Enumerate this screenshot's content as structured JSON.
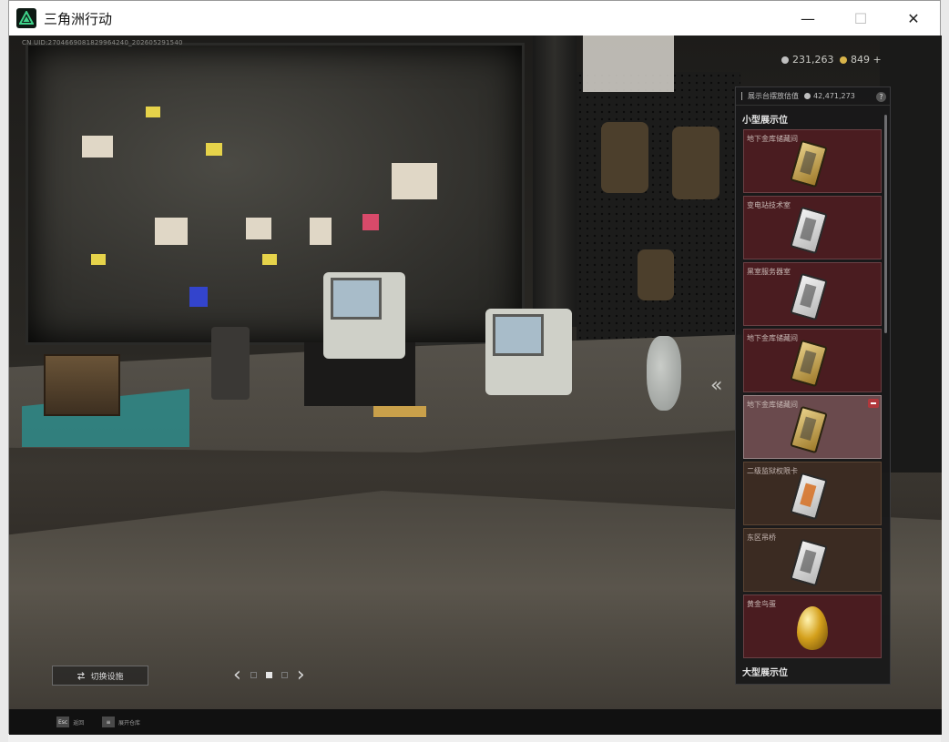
{
  "window": {
    "title": "三角洲行动",
    "controls": {
      "minimize": "—",
      "maximize": "☐",
      "close": "✕"
    }
  },
  "uid_text": "CN UID:2704669081829964240_202605291540",
  "currency": [
    {
      "value": "231,263",
      "icon": "silver-coin-icon",
      "color": "#bfbfbf"
    },
    {
      "value": "849 +",
      "icon": "gold-coin-icon",
      "color": "#d9b44a"
    }
  ],
  "panel": {
    "header_label": "展示台摆放估值",
    "header_value": "42,471,273",
    "help_label": "?",
    "small_section_title": "小型展示位",
    "large_section_title": "大型展示位",
    "slots": [
      {
        "name": "地下金库储藏间",
        "item": "gold-keycard",
        "style": "red"
      },
      {
        "name": "变电站技术室",
        "item": "white-keycard",
        "style": "red"
      },
      {
        "name": "黑室服务器室",
        "item": "white-keycard",
        "style": "red"
      },
      {
        "name": "地下金库储藏间",
        "item": "gold-keycard",
        "style": "red"
      },
      {
        "name": "地下金库储藏间",
        "item": "gold-keycard",
        "style": "selected"
      },
      {
        "name": "二级监狱权限卡",
        "item": "white-orange-keycard",
        "style": "brown"
      },
      {
        "name": "东区吊桥",
        "item": "white-keycard",
        "style": "brown"
      },
      {
        "name": "黄金鸟蛋",
        "item": "golden-egg",
        "style": "red"
      }
    ]
  },
  "collapse_label": "«",
  "switch_button": {
    "label": "切换设施",
    "icon": "swap-icon"
  },
  "pager": {
    "prev": "‹",
    "next": "›",
    "pages": 3,
    "active": 2
  },
  "bottom_hints": [
    {
      "key": "Esc",
      "label": "返回"
    },
    {
      "key": "≡",
      "label": "展开仓库"
    }
  ]
}
